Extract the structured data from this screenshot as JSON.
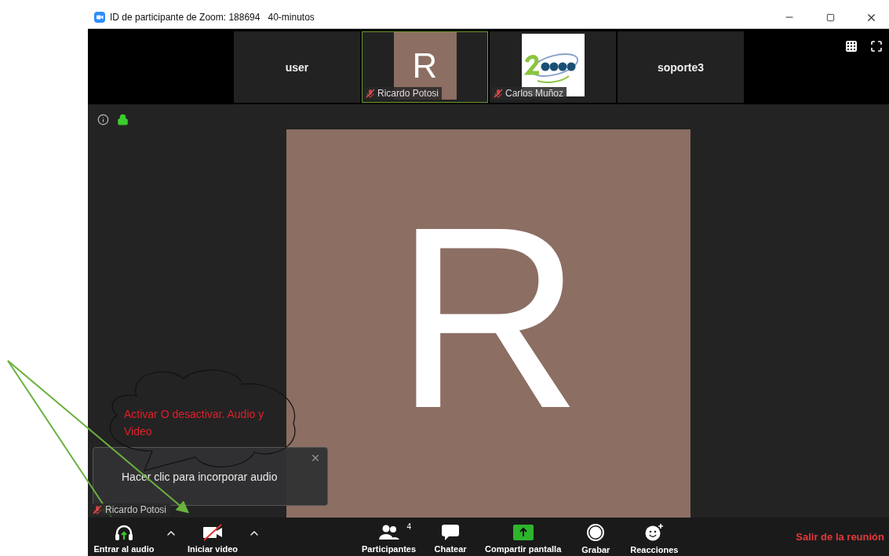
{
  "window": {
    "title": "ID de participante de Zoom: 188694   40-minutos"
  },
  "thumbnails": [
    {
      "kind": "name",
      "name": "user",
      "selected": false
    },
    {
      "kind": "avatar",
      "letter": "R",
      "label": "Ricardo Potosi",
      "muted": true,
      "selected": true
    },
    {
      "kind": "logo",
      "label": "Carlos Muñoz",
      "muted": true,
      "selected": false
    },
    {
      "kind": "name",
      "name": "soporte3",
      "selected": false
    }
  ],
  "main": {
    "letter": "R",
    "name_label": "Ricardo Potosi",
    "muted": true
  },
  "notification": {
    "text": "Hacer clic para incorporar audio"
  },
  "annotation": {
    "text": "Activar O desactivar. Audio y Video"
  },
  "toolbar": [
    {
      "kind": "audio",
      "label": "Entrar al audio",
      "caret": true
    },
    {
      "kind": "video",
      "label": "Iniciar video",
      "caret": true
    },
    {
      "kind": "participants",
      "label": "Participantes",
      "badge": "4"
    },
    {
      "kind": "chat",
      "label": "Chatear"
    },
    {
      "kind": "share",
      "label": "Compartir pantalla"
    },
    {
      "kind": "record",
      "label": "Grabar"
    },
    {
      "kind": "reactions",
      "label": "Reacciones"
    }
  ],
  "leave": {
    "label": "Salir de la reunión"
  }
}
